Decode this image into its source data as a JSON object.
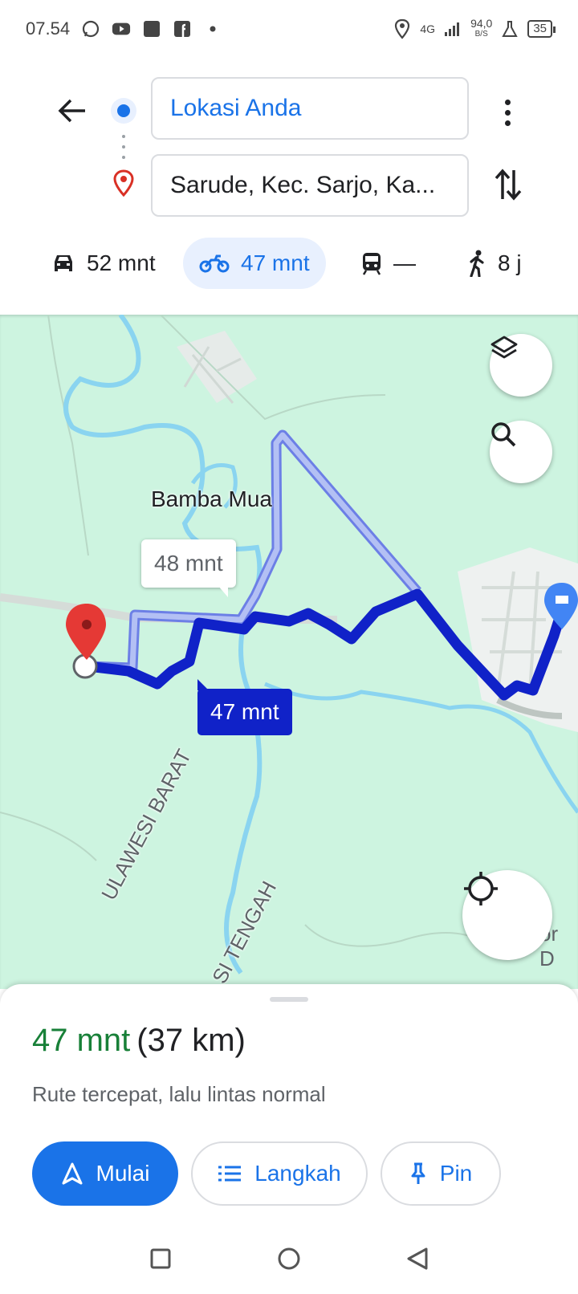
{
  "status_bar": {
    "time": "07.54",
    "network": "4G",
    "speed": "94,0",
    "speed_unit": "B/S",
    "battery": "35",
    "icons": [
      "whatsapp-icon",
      "youtube-icon",
      "app-icon",
      "facebook-icon",
      "dot-icon",
      "location-icon",
      "signal-icon",
      "lab-icon",
      "battery-icon"
    ]
  },
  "search": {
    "origin": "Lokasi Anda",
    "destination": "Sarude, Kec. Sarjo, Ka..."
  },
  "modes": [
    {
      "name": "car",
      "label": "52 mnt"
    },
    {
      "name": "motorcycle",
      "label": "47 mnt",
      "selected": true
    },
    {
      "name": "transit",
      "label": "—"
    },
    {
      "name": "walk",
      "label": "8 j"
    }
  ],
  "map": {
    "place_label": "Bamba Mua",
    "alt_route_time": "48 mnt",
    "main_route_time": "47 mnt",
    "region_label_1": "ULAWESI BARAT",
    "region_label_2": "SI TENGAH",
    "edge_label": "or D",
    "colors": {
      "water": "#8ad4f0",
      "land": "#cdf4e0",
      "route": "#1022c8",
      "alt_route": "#a9b6f2"
    }
  },
  "sheet": {
    "duration": "47 mnt",
    "distance": "(37 km)",
    "description": "Rute tercepat, lalu lintas normal",
    "start_label": "Mulai",
    "steps_label": "Langkah",
    "pin_label": "Pin"
  }
}
